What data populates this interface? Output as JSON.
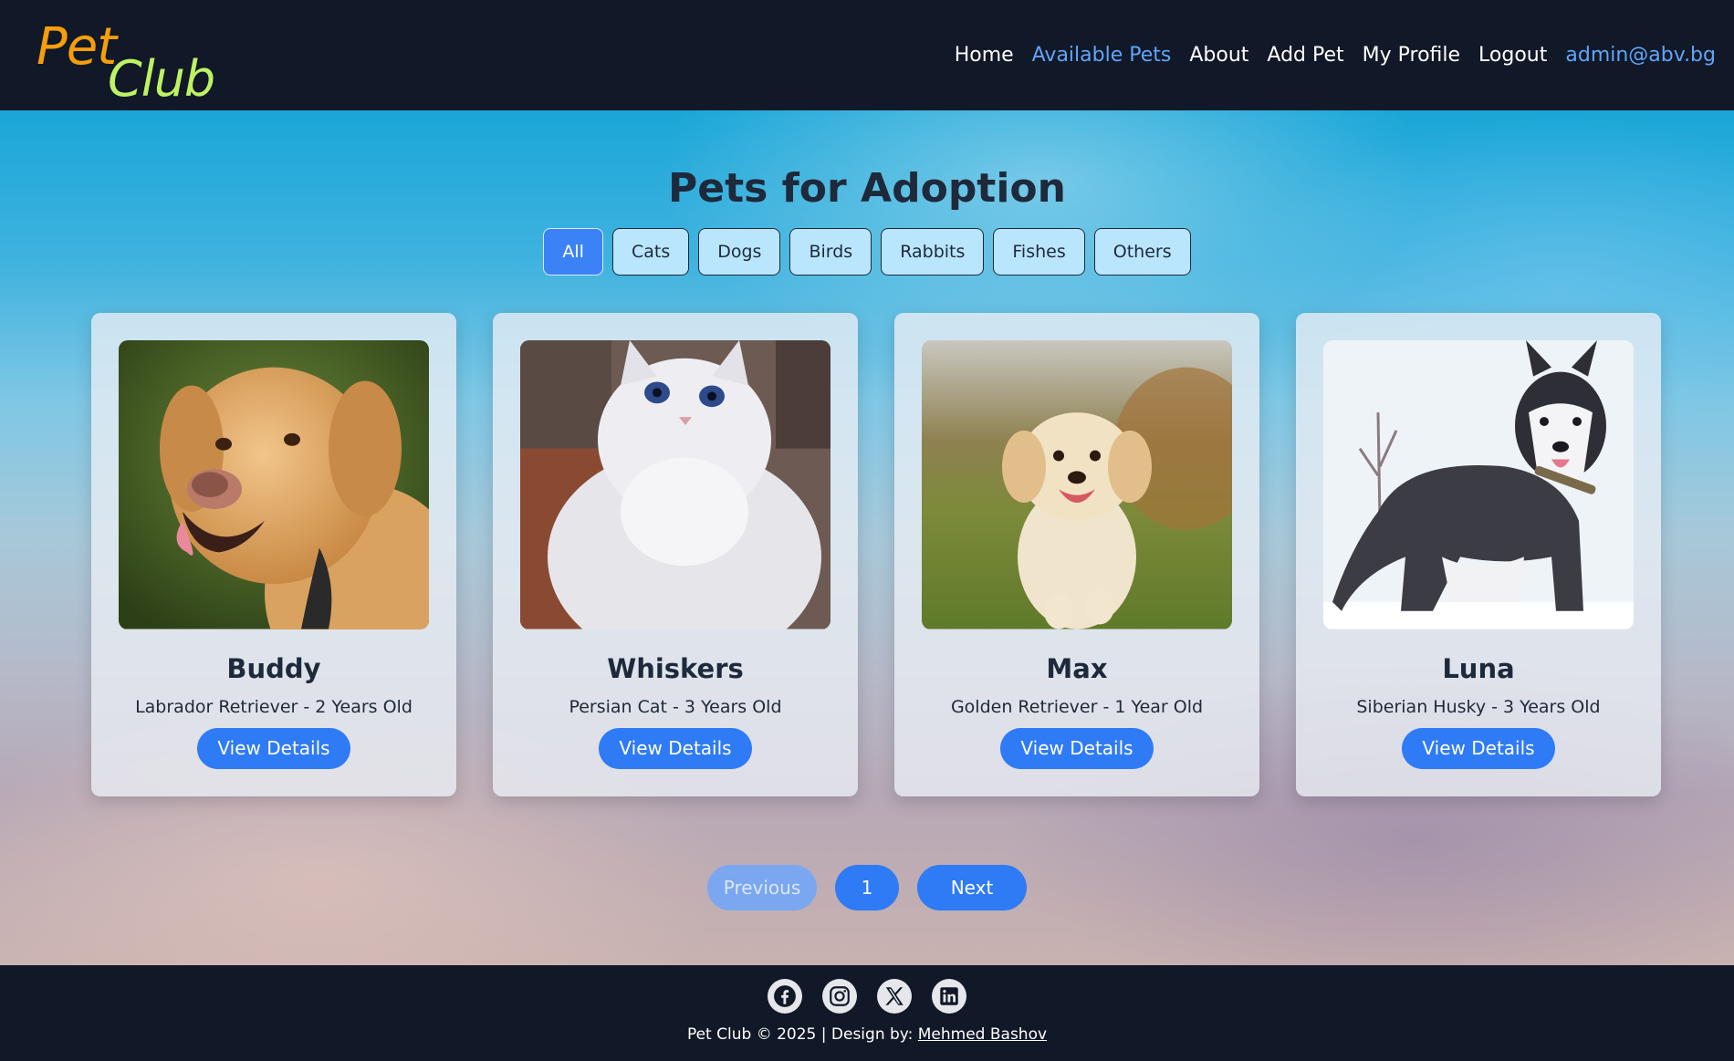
{
  "header": {
    "logo_part1": "Pet",
    "logo_part2": "Club",
    "nav": [
      {
        "label": "Home",
        "active": false
      },
      {
        "label": "Available Pets",
        "active": true
      },
      {
        "label": "About",
        "active": false
      },
      {
        "label": "Add Pet",
        "active": false
      },
      {
        "label": "My Profile",
        "active": false
      },
      {
        "label": "Logout",
        "active": false
      }
    ],
    "user_email": "admin@abv.bg"
  },
  "main": {
    "title": "Pets for Adoption",
    "filters": [
      "All",
      "Cats",
      "Dogs",
      "Birds",
      "Rabbits",
      "Fishes",
      "Others"
    ],
    "active_filter": "All",
    "pets": [
      {
        "name": "Buddy",
        "description": "Labrador Retriever - 2 Years Old",
        "image": "dog-labrador-photo",
        "button": "View Details"
      },
      {
        "name": "Whiskers",
        "description": "Persian Cat - 3 Years Old",
        "image": "cat-persian-photo",
        "button": "View Details"
      },
      {
        "name": "Max",
        "description": "Golden Retriever - 1 Year Old",
        "image": "puppy-golden-photo",
        "button": "View Details"
      },
      {
        "name": "Luna",
        "description": "Siberian Husky - 3 Years Old",
        "image": "dog-husky-photo",
        "button": "View Details"
      }
    ],
    "pagination": {
      "previous": "Previous",
      "current_page": "1",
      "next": "Next"
    }
  },
  "footer": {
    "social": [
      "facebook-icon",
      "instagram-icon",
      "x-icon",
      "linkedin-icon"
    ],
    "copyright": "Pet Club © 2025 | Design by:",
    "designer": "Mehmed Bashov"
  },
  "colors": {
    "header_bg": "#111827",
    "accent": "#2f7bf5",
    "active_nav": "#60a5fa",
    "logo_pet": "#f59e0b",
    "logo_club": "#bef264"
  }
}
